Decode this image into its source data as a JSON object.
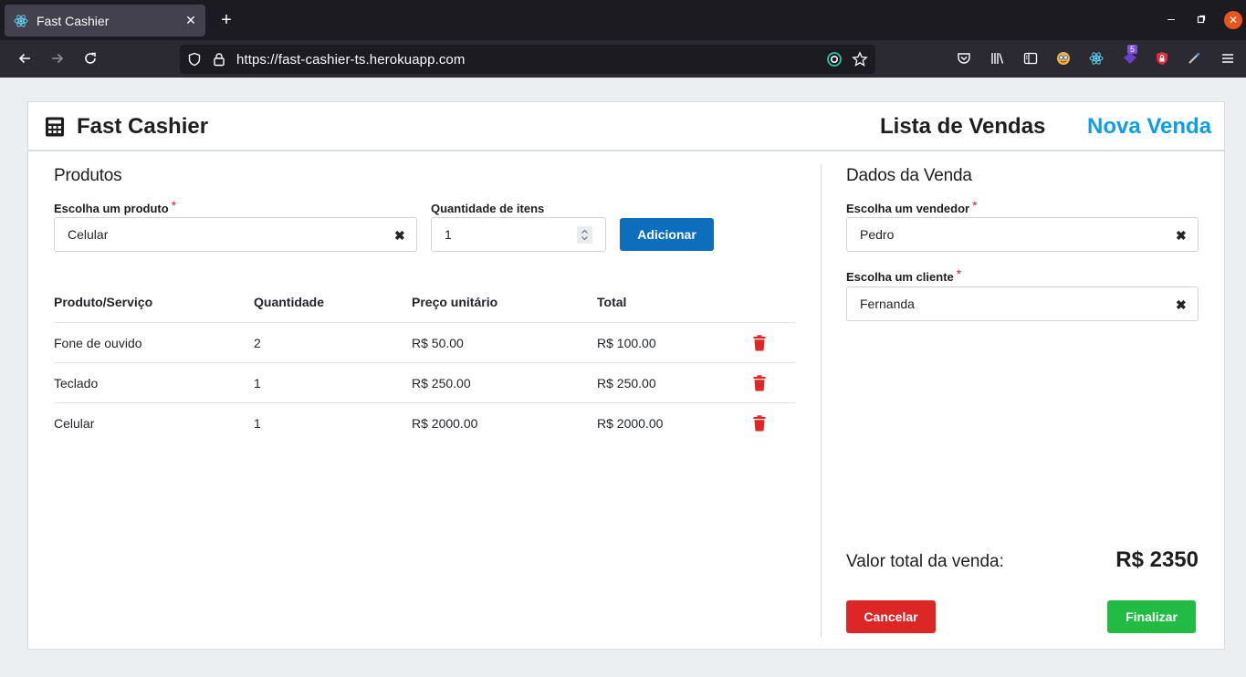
{
  "browser": {
    "tab_title": "Fast Cashier",
    "url": "https://fast-cashier-ts.herokuapp.com",
    "extension_badge": "5"
  },
  "header": {
    "brand": "Fast Cashier",
    "nav": [
      {
        "label": "Lista de Vendas",
        "active": false
      },
      {
        "label": "Nova Venda",
        "active": true
      }
    ]
  },
  "products": {
    "title": "Produtos",
    "product_label": "Escolha um produto",
    "product_value": "Celular",
    "qty_label": "Quantidade de itens",
    "qty_value": "1",
    "add_button": "Adicionar",
    "columns": [
      "Produto/Serviço",
      "Quantidade",
      "Preço unitário",
      "Total"
    ],
    "rows": [
      {
        "name": "Fone de ouvido",
        "qty": "2",
        "unit": "R$ 50.00",
        "total": "R$ 100.00"
      },
      {
        "name": "Teclado",
        "qty": "1",
        "unit": "R$ 250.00",
        "total": "R$ 250.00"
      },
      {
        "name": "Celular",
        "qty": "1",
        "unit": "R$ 2000.00",
        "total": "R$ 2000.00"
      }
    ]
  },
  "sale": {
    "title": "Dados da Venda",
    "seller_label": "Escolha um vendedor",
    "seller_value": "Pedro",
    "client_label": "Escolha um cliente",
    "client_value": "Fernanda",
    "total_label": "Valor total da venda:",
    "total_value": "R$ 2350",
    "cancel_button": "Cancelar",
    "finish_button": "Finalizar"
  },
  "colors": {
    "accent": "#0d9ee5",
    "primary_button": "#0d6ebd",
    "danger": "#dd2626",
    "success": "#22bb44"
  }
}
